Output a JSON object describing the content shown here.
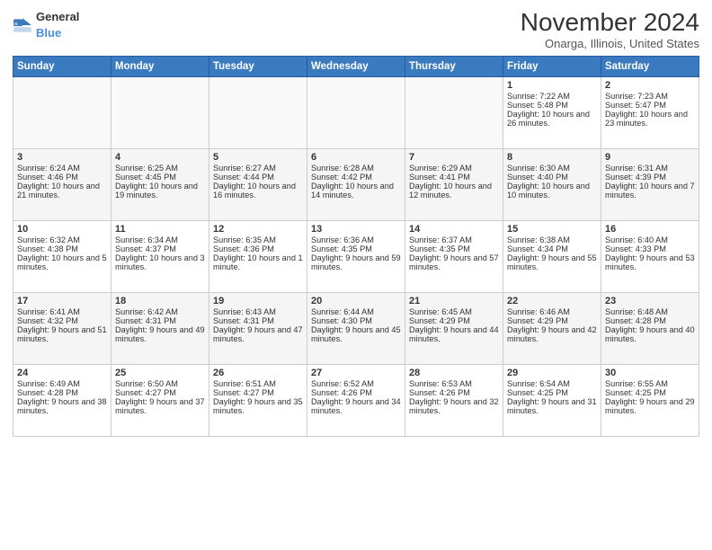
{
  "logo": {
    "general": "General",
    "blue": "Blue"
  },
  "header": {
    "month": "November 2024",
    "location": "Onarga, Illinois, United States"
  },
  "days_of_week": [
    "Sunday",
    "Monday",
    "Tuesday",
    "Wednesday",
    "Thursday",
    "Friday",
    "Saturday"
  ],
  "weeks": [
    [
      {
        "day": "",
        "info": ""
      },
      {
        "day": "",
        "info": ""
      },
      {
        "day": "",
        "info": ""
      },
      {
        "day": "",
        "info": ""
      },
      {
        "day": "",
        "info": ""
      },
      {
        "day": "1",
        "info": "Sunrise: 7:22 AM\nSunset: 5:48 PM\nDaylight: 10 hours and 26 minutes."
      },
      {
        "day": "2",
        "info": "Sunrise: 7:23 AM\nSunset: 5:47 PM\nDaylight: 10 hours and 23 minutes."
      }
    ],
    [
      {
        "day": "3",
        "info": "Sunrise: 6:24 AM\nSunset: 4:46 PM\nDaylight: 10 hours and 21 minutes."
      },
      {
        "day": "4",
        "info": "Sunrise: 6:25 AM\nSunset: 4:45 PM\nDaylight: 10 hours and 19 minutes."
      },
      {
        "day": "5",
        "info": "Sunrise: 6:27 AM\nSunset: 4:44 PM\nDaylight: 10 hours and 16 minutes."
      },
      {
        "day": "6",
        "info": "Sunrise: 6:28 AM\nSunset: 4:42 PM\nDaylight: 10 hours and 14 minutes."
      },
      {
        "day": "7",
        "info": "Sunrise: 6:29 AM\nSunset: 4:41 PM\nDaylight: 10 hours and 12 minutes."
      },
      {
        "day": "8",
        "info": "Sunrise: 6:30 AM\nSunset: 4:40 PM\nDaylight: 10 hours and 10 minutes."
      },
      {
        "day": "9",
        "info": "Sunrise: 6:31 AM\nSunset: 4:39 PM\nDaylight: 10 hours and 7 minutes."
      }
    ],
    [
      {
        "day": "10",
        "info": "Sunrise: 6:32 AM\nSunset: 4:38 PM\nDaylight: 10 hours and 5 minutes."
      },
      {
        "day": "11",
        "info": "Sunrise: 6:34 AM\nSunset: 4:37 PM\nDaylight: 10 hours and 3 minutes."
      },
      {
        "day": "12",
        "info": "Sunrise: 6:35 AM\nSunset: 4:36 PM\nDaylight: 10 hours and 1 minute."
      },
      {
        "day": "13",
        "info": "Sunrise: 6:36 AM\nSunset: 4:35 PM\nDaylight: 9 hours and 59 minutes."
      },
      {
        "day": "14",
        "info": "Sunrise: 6:37 AM\nSunset: 4:35 PM\nDaylight: 9 hours and 57 minutes."
      },
      {
        "day": "15",
        "info": "Sunrise: 6:38 AM\nSunset: 4:34 PM\nDaylight: 9 hours and 55 minutes."
      },
      {
        "day": "16",
        "info": "Sunrise: 6:40 AM\nSunset: 4:33 PM\nDaylight: 9 hours and 53 minutes."
      }
    ],
    [
      {
        "day": "17",
        "info": "Sunrise: 6:41 AM\nSunset: 4:32 PM\nDaylight: 9 hours and 51 minutes."
      },
      {
        "day": "18",
        "info": "Sunrise: 6:42 AM\nSunset: 4:31 PM\nDaylight: 9 hours and 49 minutes."
      },
      {
        "day": "19",
        "info": "Sunrise: 6:43 AM\nSunset: 4:31 PM\nDaylight: 9 hours and 47 minutes."
      },
      {
        "day": "20",
        "info": "Sunrise: 6:44 AM\nSunset: 4:30 PM\nDaylight: 9 hours and 45 minutes."
      },
      {
        "day": "21",
        "info": "Sunrise: 6:45 AM\nSunset: 4:29 PM\nDaylight: 9 hours and 44 minutes."
      },
      {
        "day": "22",
        "info": "Sunrise: 6:46 AM\nSunset: 4:29 PM\nDaylight: 9 hours and 42 minutes."
      },
      {
        "day": "23",
        "info": "Sunrise: 6:48 AM\nSunset: 4:28 PM\nDaylight: 9 hours and 40 minutes."
      }
    ],
    [
      {
        "day": "24",
        "info": "Sunrise: 6:49 AM\nSunset: 4:28 PM\nDaylight: 9 hours and 38 minutes."
      },
      {
        "day": "25",
        "info": "Sunrise: 6:50 AM\nSunset: 4:27 PM\nDaylight: 9 hours and 37 minutes."
      },
      {
        "day": "26",
        "info": "Sunrise: 6:51 AM\nSunset: 4:27 PM\nDaylight: 9 hours and 35 minutes."
      },
      {
        "day": "27",
        "info": "Sunrise: 6:52 AM\nSunset: 4:26 PM\nDaylight: 9 hours and 34 minutes."
      },
      {
        "day": "28",
        "info": "Sunrise: 6:53 AM\nSunset: 4:26 PM\nDaylight: 9 hours and 32 minutes."
      },
      {
        "day": "29",
        "info": "Sunrise: 6:54 AM\nSunset: 4:25 PM\nDaylight: 9 hours and 31 minutes."
      },
      {
        "day": "30",
        "info": "Sunrise: 6:55 AM\nSunset: 4:25 PM\nDaylight: 9 hours and 29 minutes."
      }
    ]
  ]
}
